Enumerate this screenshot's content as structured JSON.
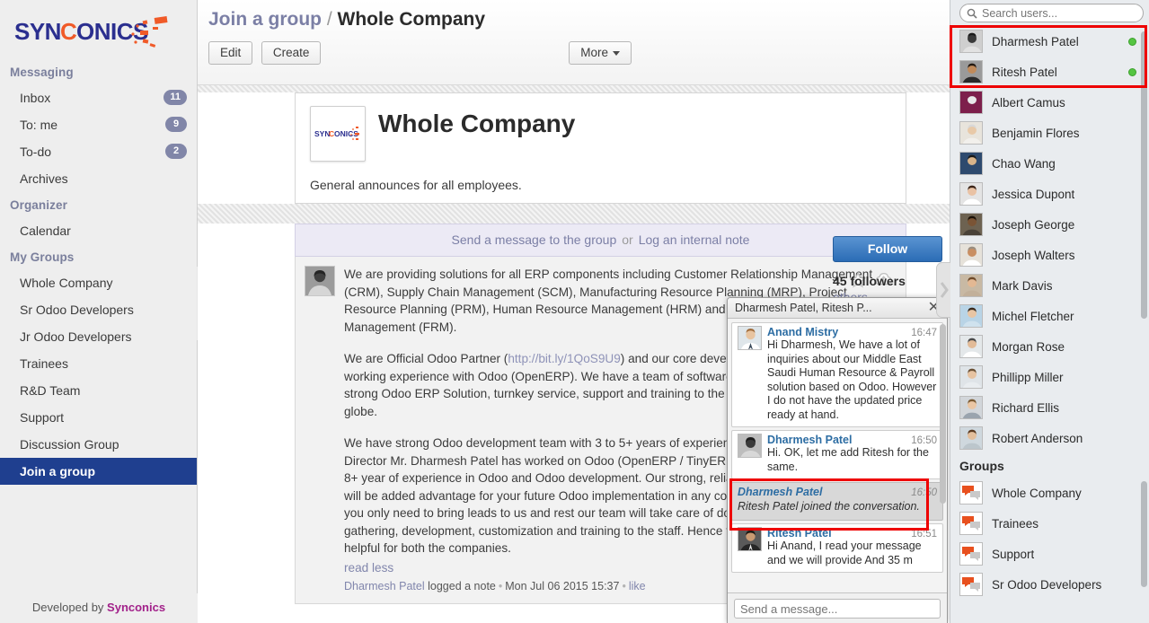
{
  "brand": {
    "name": "SYNCONICS",
    "footer_prefix": "Developed by ",
    "footer_name": "Synconics"
  },
  "sidebar": {
    "sections": [
      {
        "title": "Messaging",
        "items": [
          {
            "label": "Inbox",
            "badge": "11"
          },
          {
            "label": "To: me",
            "badge": "9"
          },
          {
            "label": "To-do",
            "badge": "2"
          },
          {
            "label": "Archives",
            "badge": ""
          }
        ]
      },
      {
        "title": "Organizer",
        "items": [
          {
            "label": "Calendar",
            "badge": ""
          }
        ]
      },
      {
        "title": "My Groups",
        "items": [
          {
            "label": "Whole Company",
            "badge": ""
          },
          {
            "label": "Sr Odoo Developers",
            "badge": ""
          },
          {
            "label": "Jr Odoo Developers",
            "badge": ""
          },
          {
            "label": "Trainees",
            "badge": ""
          },
          {
            "label": "R&D Team",
            "badge": ""
          },
          {
            "label": "Support",
            "badge": ""
          },
          {
            "label": "Discussion Group",
            "badge": ""
          },
          {
            "label": "Join a group",
            "badge": "",
            "active": true
          }
        ]
      }
    ]
  },
  "topbar": {
    "breadcrumb_root": "Join a group",
    "breadcrumb_sep": "/",
    "breadcrumb_current": "Whole Company",
    "edit_label": "Edit",
    "create_label": "Create",
    "more_label": "More"
  },
  "record": {
    "title": "Whole Company",
    "description": "General announces for all employees.",
    "thumb_logo": "SYNCONICS"
  },
  "wall": {
    "composer_send": "Send a message to the group",
    "composer_or": "or",
    "composer_note": "Log an internal note",
    "message": {
      "paragraphs": [
        "We are providing solutions for all ERP components including Customer Relationship Management (CRM), Supply Chain Management (SCM), Manufacturing Resource Planning (MRP), Project Resource Planning (PRM), Human Resource Management (HRM) and Finance Resource Management (FRM).",
        "We are Official Odoo Partner (LINK) and our core development team has 8+ years of working experience with Odoo (OpenERP). We have a team of software engineers who are giving strong Odoo ERP Solution, turnkey service, support and training to the clients from different part of the globe.",
        "We have strong Odoo development team with 3 to 5+ years of experience specially in Odoo and our Director Mr. Dharmesh Patel has worked on Odoo (OpenERP / TinyERP) since version 4.2 and has 8+ year of experience in Odoo and Odoo development. Our strong, reliable Odoo development team will be added advantage for your future Odoo implementation in any company. For implementation you only need to bring leads to us and rest our team will take care of doing gap analysis, information gathering, development, customization and training to the staff. Hence this collaboration will be really helpful for both the companies."
      ],
      "link_text": "http://bit.ly/1QoS9U9",
      "read_less": "read less",
      "author": "Dharmesh Patel",
      "action": "logged a note",
      "timestamp": "Mon Jul 06 2015 15:37",
      "like": "like"
    },
    "follow_label": "Follow",
    "follow_count": "45 followers",
    "follow_others": "others"
  },
  "chat": {
    "title": "Dharmesh Patel, Ritesh P...",
    "close_icon": "close-icon",
    "input_placeholder": "Send a message...",
    "messages": [
      {
        "name": "Anand Mistry",
        "time": "16:47",
        "text": "Hi Dharmesh, We have a lot of inquiries about our Middle East Saudi Human Resource & Payroll solution based on Odoo. However I do not have the updated price ready at hand.",
        "system": false
      },
      {
        "name": "Dharmesh Patel",
        "time": "16:50",
        "text": "Hi. OK, let me add Ritesh for the same.",
        "system": false
      },
      {
        "name": "Dharmesh Patel",
        "time": "16:50",
        "text": "Ritesh Patel joined the conversation.",
        "system": true
      },
      {
        "name": "Ritesh Patel",
        "time": "16:51",
        "text": "Hi Anand, I read your message and we will provide And 35 m",
        "system": false
      }
    ]
  },
  "rightpanel": {
    "search_placeholder": "Search users...",
    "users": [
      {
        "name": "Dharmesh Patel",
        "online": true,
        "highlight": true
      },
      {
        "name": "Ritesh Patel",
        "online": true,
        "highlight": true
      },
      {
        "name": "Albert Camus",
        "online": false
      },
      {
        "name": "Benjamin Flores",
        "online": false
      },
      {
        "name": "Chao Wang",
        "online": false
      },
      {
        "name": "Jessica Dupont",
        "online": false
      },
      {
        "name": "Joseph George",
        "online": false
      },
      {
        "name": "Joseph Walters",
        "online": false
      },
      {
        "name": "Mark Davis",
        "online": false
      },
      {
        "name": "Michel Fletcher",
        "online": false
      },
      {
        "name": "Morgan Rose",
        "online": false
      },
      {
        "name": "Phillipp Miller",
        "online": false
      },
      {
        "name": "Richard Ellis",
        "online": false
      },
      {
        "name": "Robert Anderson",
        "online": false
      }
    ],
    "groups_title": "Groups",
    "groups": [
      {
        "name": "Whole Company"
      },
      {
        "name": "Trainees"
      },
      {
        "name": "Support"
      },
      {
        "name": "Sr Odoo Developers"
      }
    ]
  },
  "colors": {
    "accent_blue": "#1f3f8f",
    "brand_orange": "#f05a28",
    "online_green": "#55c542",
    "annotation_red": "#ee0000",
    "link_purple": "#8186ac"
  }
}
